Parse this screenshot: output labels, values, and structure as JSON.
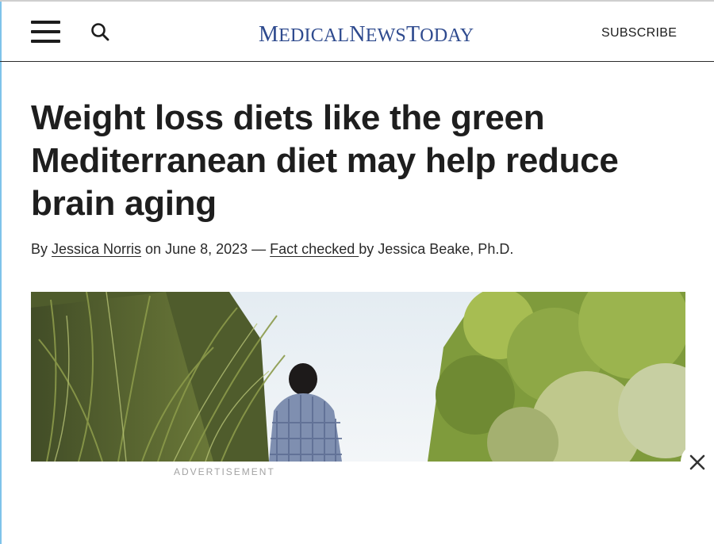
{
  "header": {
    "logo": {
      "part1_initial": "M",
      "part1_rest": "EDICAL",
      "part2_initial": "N",
      "part2_rest": "EWS",
      "part3_initial": "T",
      "part3_rest": "ODAY"
    },
    "subscribe_label": "SUBSCRIBE",
    "menu_icon": "hamburger-menu-icon",
    "search_icon": "search-icon"
  },
  "article": {
    "headline": "Weight loss diets like the green Mediterranean diet may help reduce brain aging",
    "byline": {
      "by": "By ",
      "author": "Jessica Norris",
      "on_date": " on June 8, 2023 — ",
      "fact_checked": "Fact checked ",
      "by_reviewer": "by Jessica Beake, Ph.D."
    }
  },
  "ad": {
    "label": "ADVERTISEMENT",
    "close_icon": "close-icon"
  },
  "colors": {
    "logo": "#2e4a8e",
    "text": "#1e1e1e",
    "divider": "#2a2a2a",
    "ad_label": "#a3a3a3"
  }
}
